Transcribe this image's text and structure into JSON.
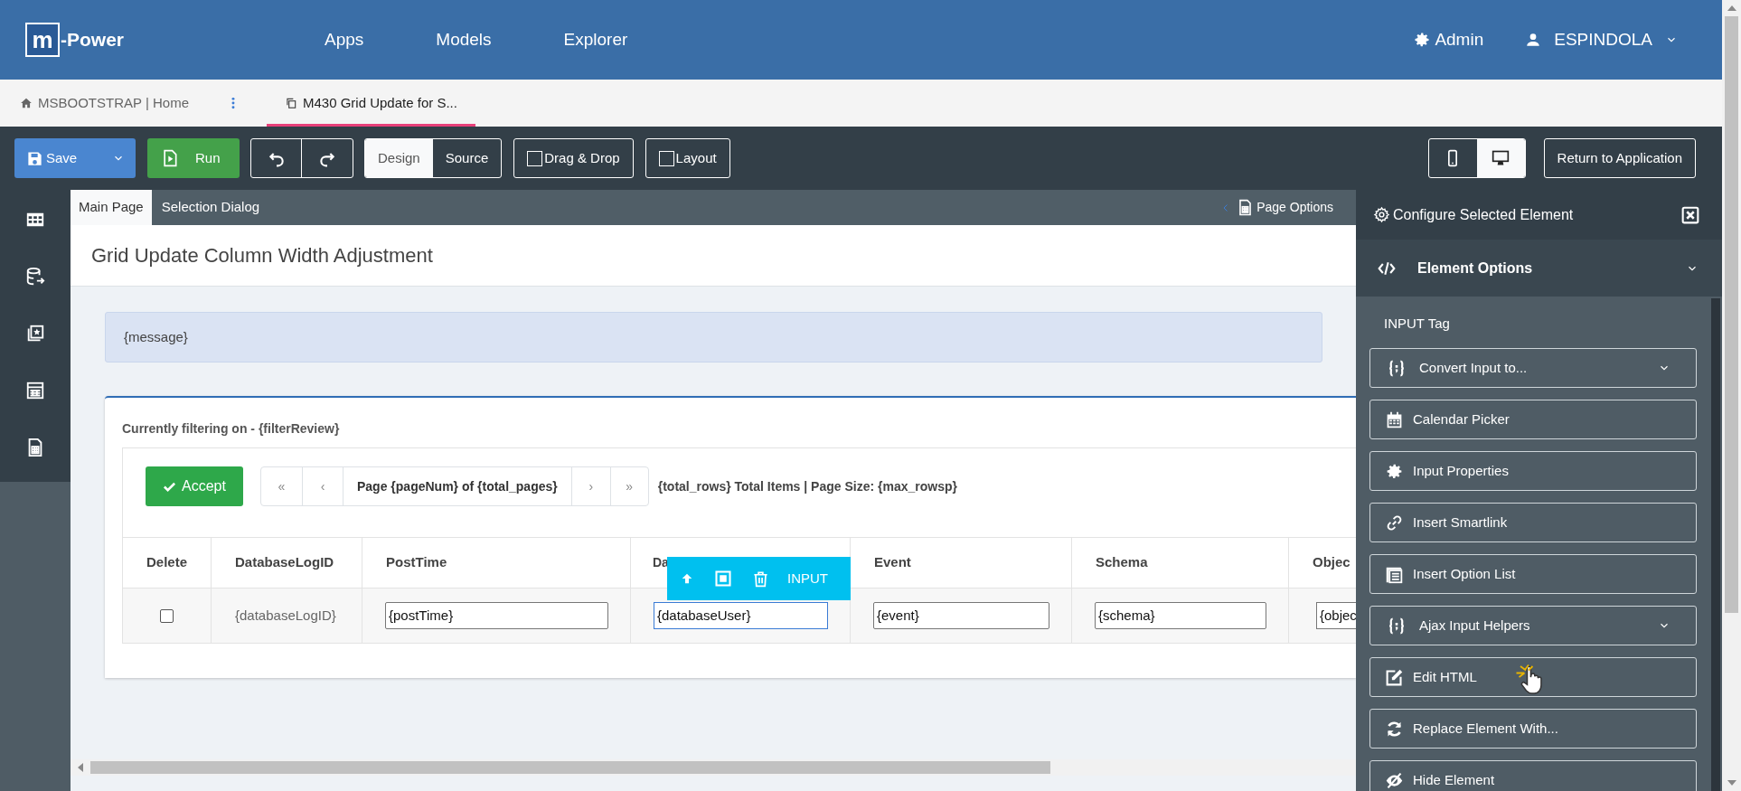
{
  "header": {
    "logo_letter": "m",
    "logo_text": "-Power",
    "nav": [
      "Apps",
      "Models",
      "Explorer"
    ],
    "admin": "Admin",
    "user": "ESPINDOLA"
  },
  "tabs": [
    {
      "label": "MSBOOTSTRAP | Home",
      "selected": false
    },
    {
      "label": "M430 Grid Update for S...",
      "selected": true
    }
  ],
  "toolbar": {
    "save": "Save",
    "run": "Run",
    "modes": [
      {
        "label": "Design",
        "selected": true
      },
      {
        "label": "Source",
        "selected": false
      }
    ],
    "toggles": [
      {
        "label": "Drag & Drop",
        "checked": false
      },
      {
        "label": "Layout",
        "checked": false
      }
    ],
    "devices": [
      {
        "kind": "phone",
        "selected": false
      },
      {
        "kind": "desktop",
        "selected": true
      }
    ],
    "return": "Return to Application"
  },
  "page_tabs": [
    {
      "label": "Main Page",
      "selected": true
    },
    {
      "label": "Selection Dialog",
      "selected": false
    }
  ],
  "page_options": "Page Options",
  "page": {
    "title": "Grid Update Column Width Adjustment",
    "message": "{message}",
    "filter": "Currently filtering on - {filterReview}",
    "accept": "Accept",
    "pager": {
      "first": "«",
      "prev": "‹",
      "label": "Page {pageNum} of {total_pages}",
      "next": "›",
      "last": "»"
    },
    "summary": "{total_rows} Total Items | Page Size: {max_rowsp}",
    "table": {
      "columns": [
        "Delete",
        "DatabaseLogID",
        "PostTime",
        "Da",
        "Event",
        "Schema",
        "Objec"
      ],
      "rows": [
        {
          "cells": [
            {
              "kind": "checkbox",
              "checked": false
            },
            {
              "kind": "text",
              "text": "{databaseLogID}"
            },
            {
              "kind": "input",
              "value": "{postTime}",
              "selected": false
            },
            {
              "kind": "input",
              "value": "{databaseUser}",
              "selected": true
            },
            {
              "kind": "input",
              "value": "{event}",
              "selected": false
            },
            {
              "kind": "input",
              "value": "{schema}",
              "selected": false
            },
            {
              "kind": "input",
              "value": "{objec",
              "selected": false
            }
          ]
        }
      ]
    },
    "element_toolbar": {
      "label": "INPUT"
    }
  },
  "panel": {
    "title": "Configure Selected Element",
    "section": {
      "label": "Element Options",
      "expanded": true
    },
    "tag_label": "INPUT Tag",
    "actions": [
      {
        "label": "Convert Input to...",
        "kind": "braces",
        "dropdown": true
      },
      {
        "label": "Calendar Picker",
        "kind": "calendar",
        "dropdown": false
      },
      {
        "label": "Input Properties",
        "kind": "gear",
        "dropdown": false
      },
      {
        "label": "Insert Smartlink",
        "kind": "link",
        "dropdown": false
      },
      {
        "label": "Insert Option List",
        "kind": "list",
        "dropdown": false
      },
      {
        "label": "Ajax Input Helpers",
        "kind": "braces",
        "dropdown": true
      },
      {
        "label": "Edit HTML",
        "kind": "edit",
        "dropdown": false
      },
      {
        "label": "Replace Element With...",
        "kind": "refresh",
        "dropdown": false
      },
      {
        "label": "Hide Element",
        "kind": "hide",
        "dropdown": false
      }
    ]
  }
}
